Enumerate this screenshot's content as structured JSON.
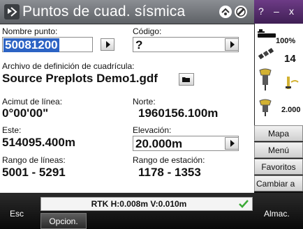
{
  "window": {
    "title": "Puntos de cuad. sísmica",
    "system_buttons": [
      "?",
      "–",
      "x"
    ]
  },
  "form": {
    "nombre_punto": {
      "label": "Nombre punto:",
      "value": "50081200"
    },
    "codigo": {
      "label": "Código:",
      "value": "?"
    },
    "archivo": {
      "label": "Archivo de definición de cuadrícula:",
      "value": "Source Preplots Demo1.gdf"
    },
    "acimut": {
      "label": "Acimut de línea:",
      "value": "0°00'00\""
    },
    "norte": {
      "label": "Norte:",
      "value": "1960156.100m"
    },
    "este": {
      "label": "Este:",
      "value": "514095.400m"
    },
    "elevacion": {
      "label": "Elevación:",
      "value": "20.000m"
    },
    "rango_lineas": {
      "label": "Rango de líneas:",
      "value": "5001 - 5291"
    },
    "rango_estacion": {
      "label": "Rango de estación:",
      "value": "1178 - 1353"
    }
  },
  "status_panel": {
    "battery": "100%",
    "satellites": "14",
    "antenna_height": "2.000"
  },
  "side_menu": [
    "Mapa",
    "Menú",
    "Favoritos",
    "Cambiar a"
  ],
  "status_bar": {
    "text": "RTK H:0.008m V:0.010m"
  },
  "softkeys": {
    "esc": "Esc",
    "options": "Opcion.",
    "store": "Almac."
  },
  "colors": {
    "title_bar": "#6f7277",
    "selection": "#2c63c4",
    "ok_check": "#3aaa35",
    "system_corner": "#5a2d73"
  },
  "icons": {
    "app": "app-icon",
    "gnss": "gnss-icon",
    "settings": "settings-icon",
    "battery": "battery-icon",
    "satellite": "satellite-icon",
    "receiver": "receiver-icon",
    "rod": "survey-rod-icon"
  }
}
